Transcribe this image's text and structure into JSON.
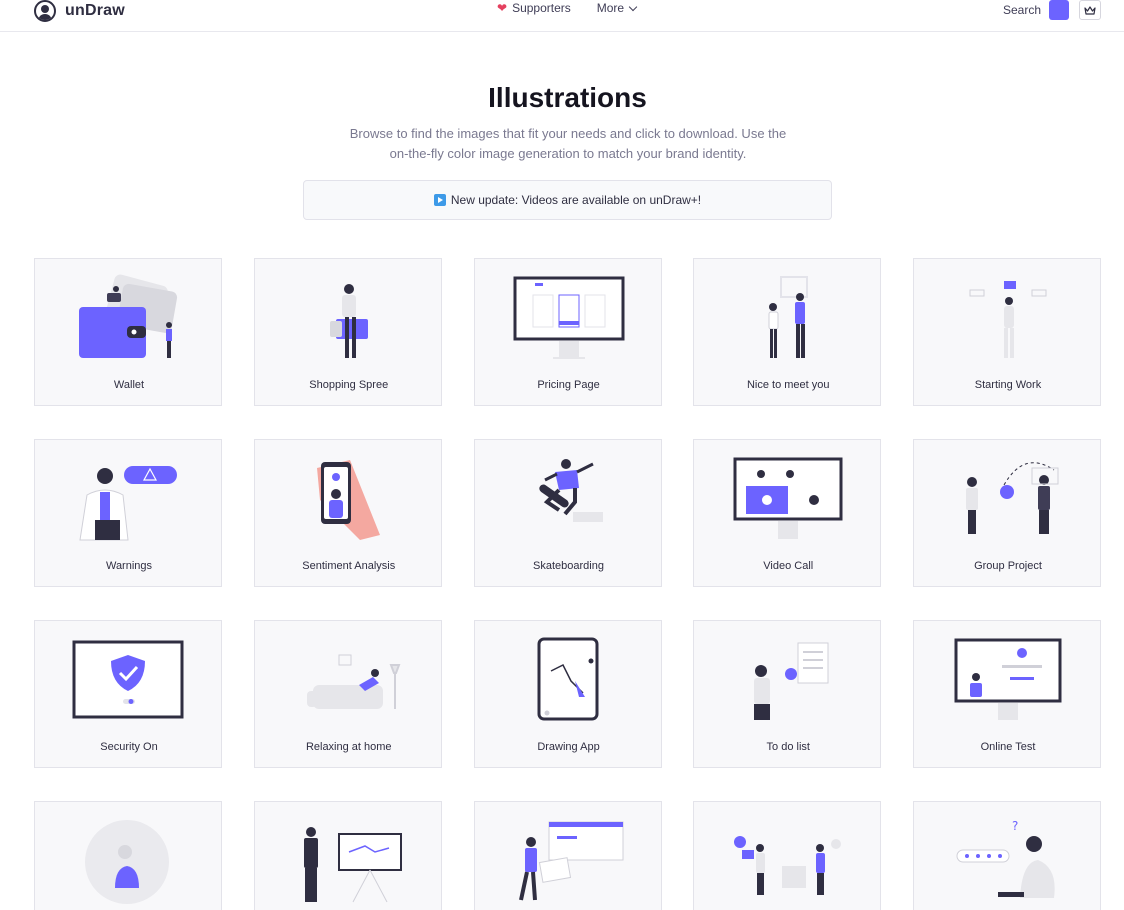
{
  "header": {
    "brand": "unDraw",
    "logo_icon": "undraw-logo-icon",
    "nav": {
      "supporters": "Supporters",
      "more": "More"
    },
    "search_label": "Search",
    "accent_color": "#6c63ff",
    "crown_icon": "crown-icon"
  },
  "hero": {
    "title": "Illustrations",
    "subtitle": "Browse to find the images that fit your needs and click to download. Use the on-the-fly color image generation to match your brand identity.",
    "banner": "New update: Videos are available on unDraw+!"
  },
  "illustrations": [
    {
      "label": "Wallet"
    },
    {
      "label": "Shopping Spree"
    },
    {
      "label": "Pricing Page"
    },
    {
      "label": "Nice to meet you"
    },
    {
      "label": "Starting Work"
    },
    {
      "label": "Warnings"
    },
    {
      "label": "Sentiment Analysis"
    },
    {
      "label": "Skateboarding"
    },
    {
      "label": "Video Call"
    },
    {
      "label": "Group Project"
    },
    {
      "label": "Security On"
    },
    {
      "label": "Relaxing at home"
    },
    {
      "label": "Drawing App"
    },
    {
      "label": "To do list"
    },
    {
      "label": "Online Test"
    },
    {
      "label": ""
    },
    {
      "label": ""
    },
    {
      "label": ""
    },
    {
      "label": ""
    },
    {
      "label": ""
    }
  ]
}
